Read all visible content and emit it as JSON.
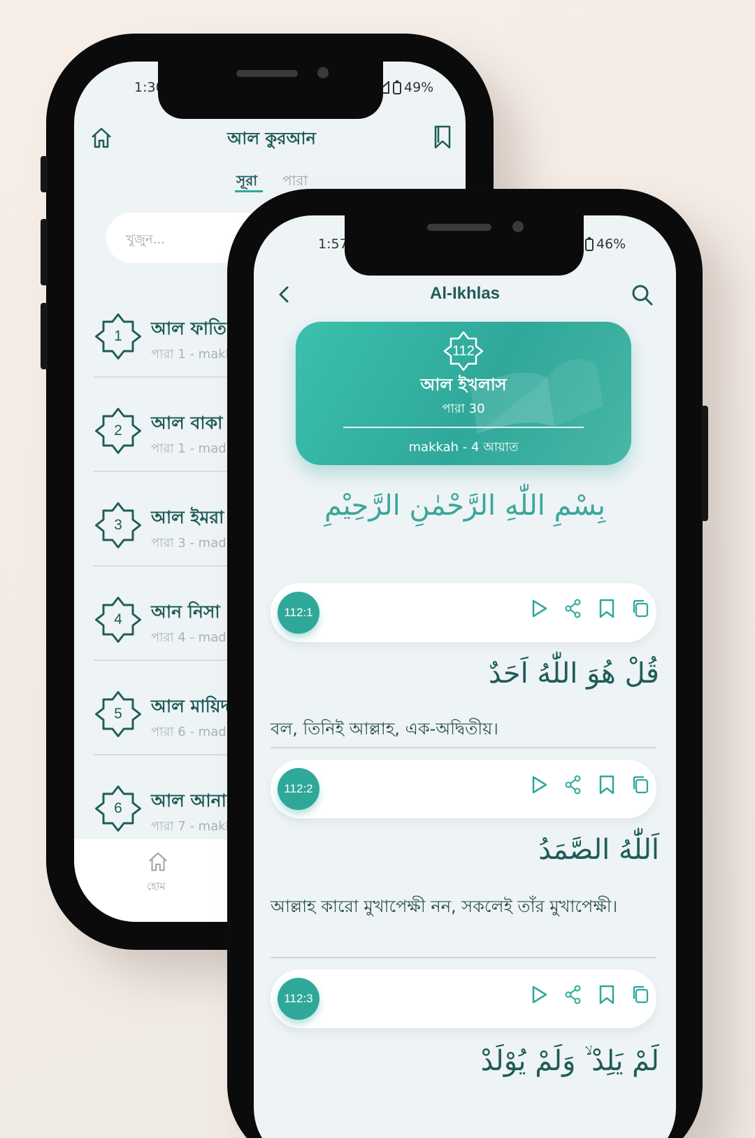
{
  "back_screen": {
    "status_time": "1:30",
    "status_battery": "49%",
    "title": "আল কুরআন",
    "tabs": [
      "সূরা",
      "পারা"
    ],
    "search_placeholder": "খুজুন...",
    "surahs": [
      {
        "number": "1",
        "name": "আল ফাতি",
        "meta": "পারা 1 - makk"
      },
      {
        "number": "2",
        "name": "আল বাকা",
        "meta": "পারা 1 - mad"
      },
      {
        "number": "3",
        "name": "আল ইমরা",
        "meta": "পারা 3 - mad"
      },
      {
        "number": "4",
        "name": "আন নিসা",
        "meta": "পারা 4 - madi"
      },
      {
        "number": "5",
        "name": "আল মায়িদ",
        "meta": "পারা 6 - madi"
      },
      {
        "number": "6",
        "name": "আল আনা",
        "meta": "পারা 7 - makk"
      }
    ],
    "bottom_nav_home": "হোম"
  },
  "front_screen": {
    "status_time": "1:57",
    "status_battery": "46%",
    "title": "Al-Ikhlas",
    "card": {
      "number": "112",
      "name": "আল ইখলাস",
      "para": "পারা 30",
      "info": "makkah - 4 আয়াত"
    },
    "bismillah": "بِسْمِ اللّٰهِ الرَّحْمٰنِ الرَّحِيْمِ",
    "verses": [
      {
        "ref": "112:1",
        "arabic": "قُلْ هُوَ اللّٰهُ اَحَدٌ",
        "translation": "বল, তিনিই আল্লাহ, এক-অদ্বিতীয়।"
      },
      {
        "ref": "112:2",
        "arabic": "اَللّٰهُ الصَّمَدُ",
        "translation": "আল্লাহ কারো মুখাপেক্ষী নন, সকলেই তাঁর মুখাপেক্ষী।"
      },
      {
        "ref": "112:3",
        "arabic": "لَمْ يَلِدْ ۙ وَلَمْ يُوْلَدْ",
        "translation": ""
      }
    ]
  },
  "colors": {
    "accent": "#2fa89a",
    "primary_text": "#1f5c58",
    "screen_bg": "#eef3f6"
  }
}
